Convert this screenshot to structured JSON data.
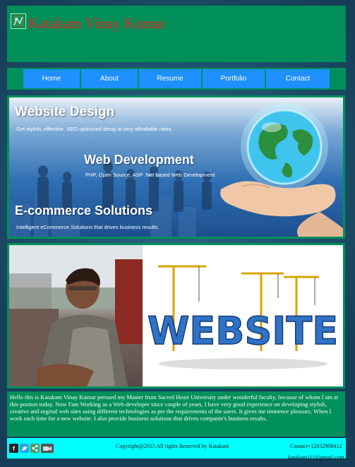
{
  "header": {
    "title": "Katakam Vinay Kumar",
    "logo_icon": "logo-icon"
  },
  "nav": {
    "items": [
      {
        "label": "Home"
      },
      {
        "label": "About"
      },
      {
        "label": "Resume"
      },
      {
        "label": "Portfolio"
      },
      {
        "label": "Contact"
      }
    ]
  },
  "banner": {
    "heading1": "Website Design",
    "sub1": "Get stylish, effective, SEO optimized desig at very affotdable rates.",
    "heading2": "Web Development",
    "sub2": "PHP, Open Source, ASP .Net based Web Development",
    "heading3": "E-commerce Solutions",
    "sub3": "Intelligent eCommerce Solutions that drives business results."
  },
  "photos": {
    "website_word": "WEBSITE"
  },
  "about": {
    "text": "Hello this is Katakam Vinay Kumar persued my Master from Sacred Heart University under wonderful faculty, because of whom I am at this postion today. Now I'am Working as a Web-developer since couple of years, I have very good experience on developing stylish, creative and orginal web sites using different technologies as per the requirements of the users. It gives me immence pleasure, When I work each time for a new website. I also provide business solutions that drives companie's business results."
  },
  "footer": {
    "copyright": "Copyright@2015 All rights Reserved by Katakam",
    "contact": "Contact+12032908412",
    "email": "katakam111@gmail.com",
    "social_icons": [
      "facebook-icon",
      "twitter-icon",
      "share-icon",
      "video-icon"
    ]
  }
}
